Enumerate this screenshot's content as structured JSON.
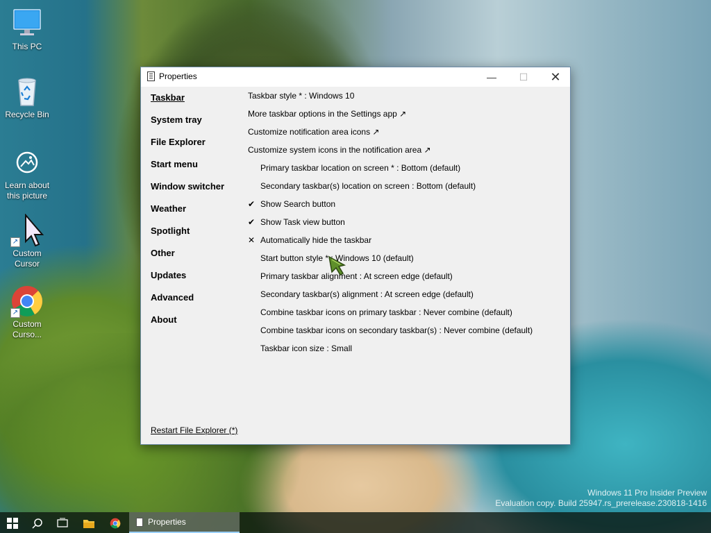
{
  "desktop": {
    "icons": [
      {
        "label": "This PC",
        "icon": "monitor-icon"
      },
      {
        "label": "Recycle Bin",
        "icon": "recycle-bin-icon"
      },
      {
        "label": "Learn about this picture",
        "icon": "info-camera-icon"
      },
      {
        "label": "Custom Cursor",
        "icon": "cursor-arrow-icon"
      },
      {
        "label": "Custom Curso...",
        "icon": "chrome-icon"
      }
    ],
    "watermark": {
      "line1": "Windows 11 Pro Insider Preview",
      "line2": "Evaluation copy. Build 25947.rs_prerelease.230818-1416"
    }
  },
  "window": {
    "title": "Properties",
    "controls": {
      "minimize": "—",
      "maximize": "☐",
      "close": "✕"
    },
    "nav": [
      {
        "label": "Taskbar",
        "active": true
      },
      {
        "label": "System tray"
      },
      {
        "label": "File Explorer"
      },
      {
        "label": "Start menu"
      },
      {
        "label": "Window switcher"
      },
      {
        "label": "Weather"
      },
      {
        "label": "Spotlight"
      },
      {
        "label": "Other"
      },
      {
        "label": "Updates"
      },
      {
        "label": "Advanced"
      },
      {
        "label": "About"
      }
    ],
    "options": [
      {
        "text": "Taskbar style * : Windows 10",
        "indent": false,
        "mark": ""
      },
      {
        "text": "More taskbar options in the Settings app ↗",
        "indent": false,
        "mark": ""
      },
      {
        "text": "Customize notification area icons ↗",
        "indent": false,
        "mark": ""
      },
      {
        "text": "Customize system icons in the notification area ↗",
        "indent": false,
        "mark": ""
      },
      {
        "text": "Primary taskbar location on screen * : Bottom (default)",
        "indent": true,
        "mark": ""
      },
      {
        "text": "Secondary taskbar(s) location on screen : Bottom (default)",
        "indent": true,
        "mark": ""
      },
      {
        "text": "Show Search button",
        "indent": true,
        "mark": "✔"
      },
      {
        "text": "Show Task view button",
        "indent": true,
        "mark": "✔"
      },
      {
        "text": "Automatically hide the taskbar",
        "indent": true,
        "mark": "✕"
      },
      {
        "text": "Start button style * : Windows 10 (default)",
        "indent": true,
        "mark": ""
      },
      {
        "text": "Primary taskbar alignment : At screen edge (default)",
        "indent": true,
        "mark": ""
      },
      {
        "text": "Secondary taskbar(s) alignment : At screen edge (default)",
        "indent": true,
        "mark": ""
      },
      {
        "text": "Combine taskbar icons on primary taskbar : Never combine (default)",
        "indent": true,
        "mark": ""
      },
      {
        "text": "Combine taskbar icons on secondary taskbar(s) : Never combine (default)",
        "indent": true,
        "mark": ""
      },
      {
        "text": "Taskbar icon size : Small",
        "indent": true,
        "mark": ""
      }
    ],
    "restart_link": "Restart File Explorer (*)"
  },
  "taskbar": {
    "buttons": [
      {
        "icon": "windows-start-icon"
      },
      {
        "icon": "search-icon"
      },
      {
        "icon": "task-view-icon"
      },
      {
        "icon": "file-explorer-icon"
      },
      {
        "icon": "chrome-icon"
      }
    ],
    "active_app": "Properties"
  }
}
